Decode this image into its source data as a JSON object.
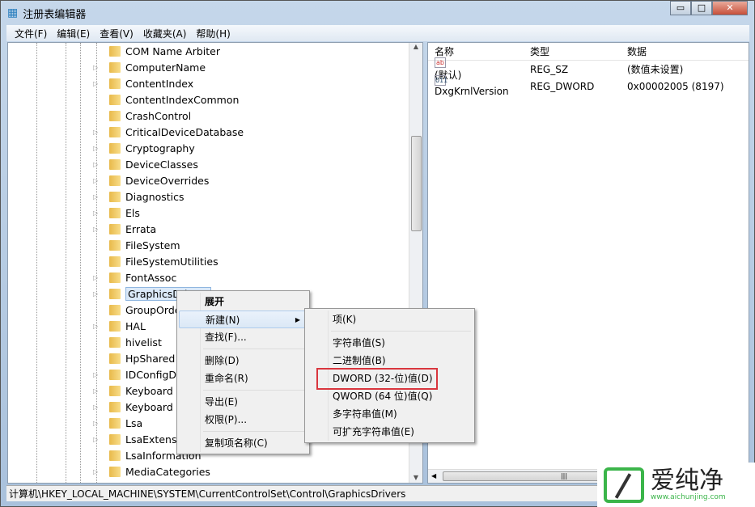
{
  "window": {
    "title": "注册表编辑器",
    "minimize": "▭",
    "maximize": "□",
    "close": "✕"
  },
  "menubar": [
    "文件(F)",
    "编辑(E)",
    "查看(V)",
    "收藏夹(A)",
    "帮助(H)"
  ],
  "tree": [
    {
      "label": "COM Name Arbiter",
      "expandable": false
    },
    {
      "label": "ComputerName",
      "expandable": true
    },
    {
      "label": "ContentIndex",
      "expandable": true
    },
    {
      "label": "ContentIndexCommon",
      "expandable": false
    },
    {
      "label": "CrashControl",
      "expandable": false
    },
    {
      "label": "CriticalDeviceDatabase",
      "expandable": true
    },
    {
      "label": "Cryptography",
      "expandable": true
    },
    {
      "label": "DeviceClasses",
      "expandable": true
    },
    {
      "label": "DeviceOverrides",
      "expandable": true
    },
    {
      "label": "Diagnostics",
      "expandable": true
    },
    {
      "label": "Els",
      "expandable": true
    },
    {
      "label": "Errata",
      "expandable": true
    },
    {
      "label": "FileSystem",
      "expandable": false
    },
    {
      "label": "FileSystemUtilities",
      "expandable": false
    },
    {
      "label": "FontAssoc",
      "expandable": true
    },
    {
      "label": "GraphicsDrivers",
      "expandable": true,
      "selected": true
    },
    {
      "label": "GroupOrderList",
      "expandable": false
    },
    {
      "label": "HAL",
      "expandable": true
    },
    {
      "label": "hivelist",
      "expandable": false
    },
    {
      "label": "HpShared",
      "expandable": false
    },
    {
      "label": "IDConfigDB",
      "expandable": true
    },
    {
      "label": "Keyboard Layout",
      "expandable": true
    },
    {
      "label": "Keyboard Layouts",
      "expandable": true
    },
    {
      "label": "Lsa",
      "expandable": true
    },
    {
      "label": "LsaExtensionConfig",
      "expandable": true
    },
    {
      "label": "LsaInformation",
      "expandable": false
    },
    {
      "label": "MediaCategories",
      "expandable": true
    }
  ],
  "list": {
    "headers": [
      "名称",
      "类型",
      "数据"
    ],
    "rows": [
      {
        "icon": "string-value-icon",
        "glyph": "ab",
        "name": "(默认)",
        "type": "REG_SZ",
        "data": "(数值未设置)"
      },
      {
        "icon": "binary-value-icon",
        "glyph": "011",
        "name": "DxgKrnlVersion",
        "type": "REG_DWORD",
        "data": "0x00002005 (8197)"
      }
    ]
  },
  "context_menu": {
    "expand": "展开",
    "new": "新建(N)",
    "find": "查找(F)...",
    "delete": "删除(D)",
    "rename": "重命名(R)",
    "export": "导出(E)",
    "permissions": "权限(P)...",
    "copy_key_name": "复制项名称(C)"
  },
  "submenu": {
    "key": "项(K)",
    "string": "字符串值(S)",
    "binary": "二进制值(B)",
    "dword": "DWORD (32-位)值(D)",
    "qword": "QWORD (64 位)值(Q)",
    "multi_string": "多字符串值(M)",
    "expandable_string": "可扩充字符串值(E)"
  },
  "highlight_color": "#d9363e",
  "status": "计算机\\HKEY_LOCAL_MACHINE\\SYSTEM\\CurrentControlSet\\Control\\GraphicsDrivers",
  "watermark": {
    "name": "爱纯净",
    "url": "www.aichunjing.com"
  }
}
